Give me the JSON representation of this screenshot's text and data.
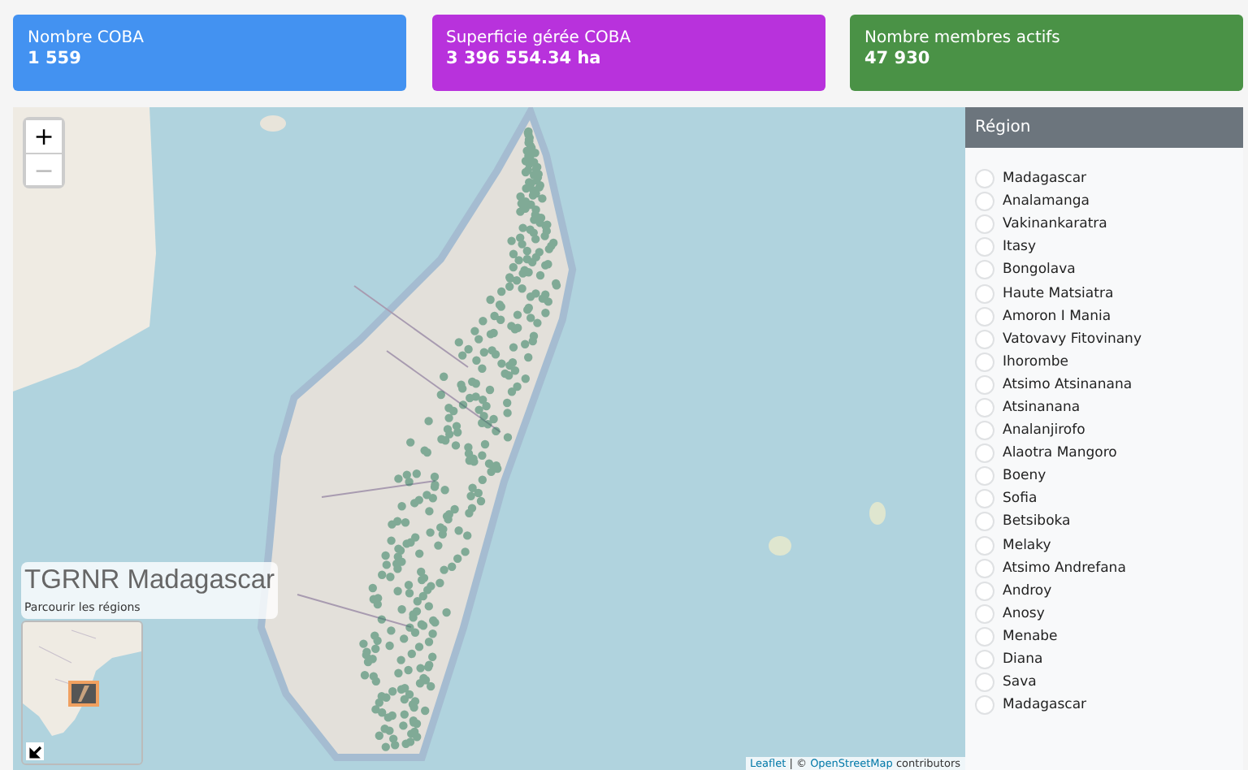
{
  "stat_cards": [
    {
      "label": "Nombre COBA",
      "value": "1 559",
      "color": "#4392f1"
    },
    {
      "label": "Superficie gérée COBA",
      "value": "3 396 554.34 ha",
      "color": "#b832dc"
    },
    {
      "label": "Nombre membres actifs",
      "value": "47 930",
      "color": "#4a9246"
    }
  ],
  "map": {
    "zoom_controls": [
      {
        "label": "+",
        "disabled": false
      },
      {
        "label": "−",
        "disabled": true
      }
    ],
    "title": "TGRNR Madagascar",
    "subtitle": "Parcourir les régions",
    "minimap": {
      "expanded": true
    },
    "attribution": {
      "prefix": "Leaflet",
      "separator": "| ©",
      "link": "OpenStreetMap",
      "suffix": "contributors"
    }
  },
  "region_panel": {
    "title": "Région",
    "items": [
      {
        "label": "Madagascar",
        "selected": false
      },
      {
        "label": "Analamanga",
        "selected": false
      },
      {
        "label": "Vakinankaratra",
        "selected": false
      },
      {
        "label": "Itasy",
        "selected": false
      },
      {
        "label": "Bongolava",
        "selected": false
      },
      {
        "label": "Haute Matsiatra",
        "selected": false
      },
      {
        "label": "Amoron I Mania",
        "selected": false
      },
      {
        "label": "Vatovavy Fitovinany",
        "selected": false
      },
      {
        "label": "Ihorombe",
        "selected": false
      },
      {
        "label": "Atsimo Atsinanana",
        "selected": false
      },
      {
        "label": "Atsinanana",
        "selected": false
      },
      {
        "label": "Analanjirofo",
        "selected": false
      },
      {
        "label": "Alaotra Mangoro",
        "selected": false
      },
      {
        "label": "Boeny",
        "selected": false
      },
      {
        "label": "Sofia",
        "selected": false
      },
      {
        "label": "Betsiboka",
        "selected": false
      },
      {
        "label": "Melaky",
        "selected": false
      },
      {
        "label": "Atsimo Andrefana",
        "selected": false
      },
      {
        "label": "Androy",
        "selected": false
      },
      {
        "label": "Anosy",
        "selected": false
      },
      {
        "label": "Menabe",
        "selected": false
      },
      {
        "label": "Diana",
        "selected": false
      },
      {
        "label": "Sava",
        "selected": false
      },
      {
        "label": "Madagascar",
        "selected": false
      }
    ]
  }
}
